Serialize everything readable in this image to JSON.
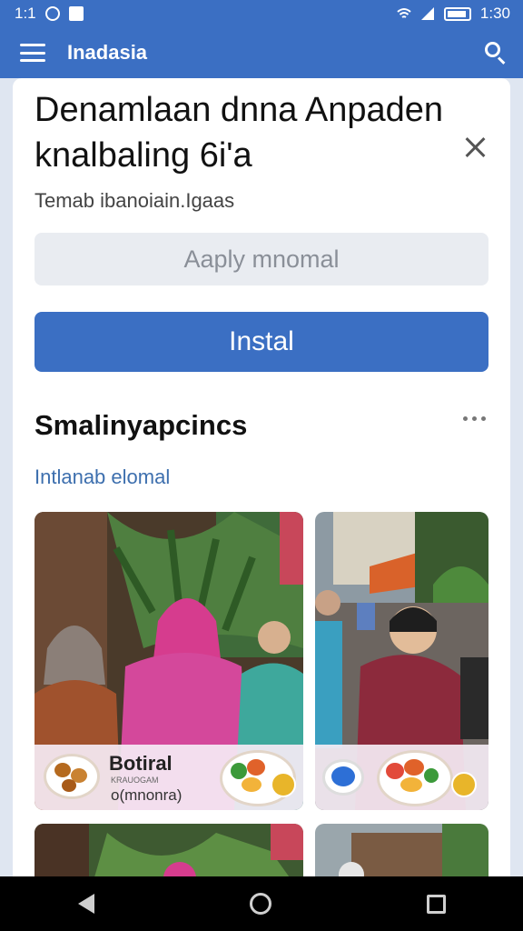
{
  "status_bar": {
    "time": "1:30",
    "left_text": "1:1"
  },
  "app_bar": {
    "title": "Inadasia"
  },
  "dialog": {
    "title": "Denamlaan dnna Anpaden knalbaling 6i'a",
    "subtitle": "Temab ibanoiain.Igaas",
    "apply_label": "Aaply mnomal",
    "install_label": "Instal"
  },
  "section": {
    "title": "Smalinyapcincs",
    "link": "Intlanab elomal"
  },
  "cards": [
    {
      "label": "Botiral",
      "sub_small": "KRAUOGAM",
      "sub": "o(mnonra)"
    },
    {
      "label": "",
      "sub_small": "",
      "sub": ""
    }
  ],
  "icons": [
    "menu-icon",
    "search-icon",
    "close-icon",
    "more-icon",
    "back-icon",
    "home-icon",
    "recents-icon"
  ],
  "colors": {
    "primary": "#3b6fc3",
    "link": "#3d6fae",
    "disabled_bg": "#e9ecf1"
  }
}
